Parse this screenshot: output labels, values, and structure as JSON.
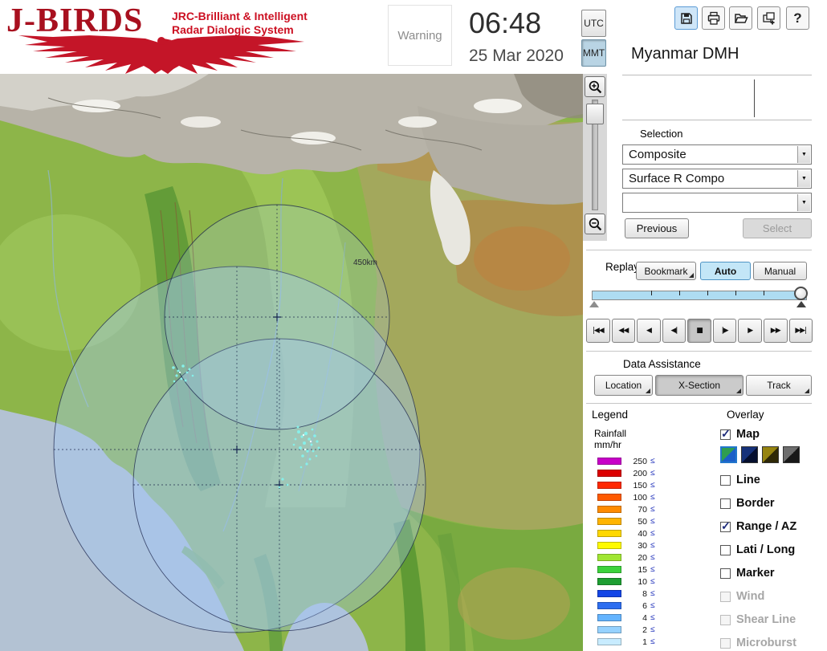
{
  "header": {
    "logo": {
      "title": "J-BIRDS",
      "tagline1": "JRC-Brilliant & Intelligent",
      "tagline2": "Radar  Dialogic  System"
    },
    "warning_label": "Warning",
    "clock": {
      "time": "06:48",
      "date": "25 Mar 2020"
    },
    "timezone": {
      "utc": "UTC",
      "mmt": "MMT",
      "selected": "MMT"
    },
    "toolbar_icons": [
      "save-icon",
      "print-icon",
      "open-folder-icon",
      "export-image-icon",
      "help-icon"
    ],
    "help_glyph": "?",
    "site_name": "Myanmar DMH"
  },
  "map": {
    "range_label": "450km"
  },
  "selection": {
    "label": "Selection",
    "product_dropdown": "Composite",
    "type_dropdown": "Surface R Compo",
    "extra_dropdown": "",
    "previous_button": "Previous",
    "select_button": "Select"
  },
  "replay": {
    "label": "Replay",
    "bookmark_button": "Bookmark",
    "auto_button": "Auto",
    "manual_button": "Manual",
    "transport": [
      "|◀◀",
      "◀◀",
      "◀",
      "◀|",
      "■",
      "|▶",
      "▶",
      "▶▶",
      "▶▶|"
    ]
  },
  "data_assistance": {
    "label": "Data Assistance",
    "location_button": "Location",
    "xsection_button": "X-Section",
    "track_button": "Track"
  },
  "legend": {
    "label": "Legend",
    "unit_line1": "Rainfall",
    "unit_line2": "mm/hr",
    "leq": "≤",
    "entries": [
      {
        "value": "250",
        "color": "#c800c8"
      },
      {
        "value": "200",
        "color": "#dc0000"
      },
      {
        "value": "150",
        "color": "#ff2800"
      },
      {
        "value": "100",
        "color": "#ff5a00"
      },
      {
        "value": "70",
        "color": "#ff8c00"
      },
      {
        "value": "50",
        "color": "#ffb400"
      },
      {
        "value": "40",
        "color": "#ffd800"
      },
      {
        "value": "30",
        "color": "#fffa00"
      },
      {
        "value": "20",
        "color": "#a0e632"
      },
      {
        "value": "15",
        "color": "#3cd23c"
      },
      {
        "value": "10",
        "color": "#1e9e32"
      },
      {
        "value": "8",
        "color": "#1446e6"
      },
      {
        "value": "6",
        "color": "#2d6ef0"
      },
      {
        "value": "4",
        "color": "#64b4ff"
      },
      {
        "value": "2",
        "color": "#96d2ff"
      },
      {
        "value": "1",
        "color": "#c8ecff"
      }
    ]
  },
  "overlay": {
    "label": "Overlay",
    "items": [
      {
        "label": "Map",
        "checked": true,
        "disabled": false
      },
      {
        "label": "Line",
        "checked": false,
        "disabled": false
      },
      {
        "label": "Border",
        "checked": false,
        "disabled": false
      },
      {
        "label": "Range / AZ",
        "checked": true,
        "disabled": false
      },
      {
        "label": "Lati / Long",
        "checked": false,
        "disabled": false
      },
      {
        "label": "Marker",
        "checked": false,
        "disabled": false
      },
      {
        "label": "Wind",
        "checked": false,
        "disabled": true
      },
      {
        "label": "Shear Line",
        "checked": false,
        "disabled": true
      },
      {
        "label": "Microburst",
        "checked": false,
        "disabled": true
      }
    ],
    "map_swatches": [
      {
        "name": "terrain-green-blue",
        "colors": [
          "#2f9e50",
          "#1b5fc8"
        ],
        "selected": true
      },
      {
        "name": "dark-blue",
        "colors": [
          "#16327a",
          "#050f2e"
        ],
        "selected": false
      },
      {
        "name": "dark-olive",
        "colors": [
          "#968410",
          "#2e2806"
        ],
        "selected": false
      },
      {
        "name": "dark-gray",
        "colors": [
          "#6e6e6e",
          "#181818"
        ],
        "selected": false
      }
    ]
  },
  "colors": {
    "logo_red": "#c41528",
    "active_blue": "#c3e6f7",
    "sea": "#b3c2d3"
  }
}
